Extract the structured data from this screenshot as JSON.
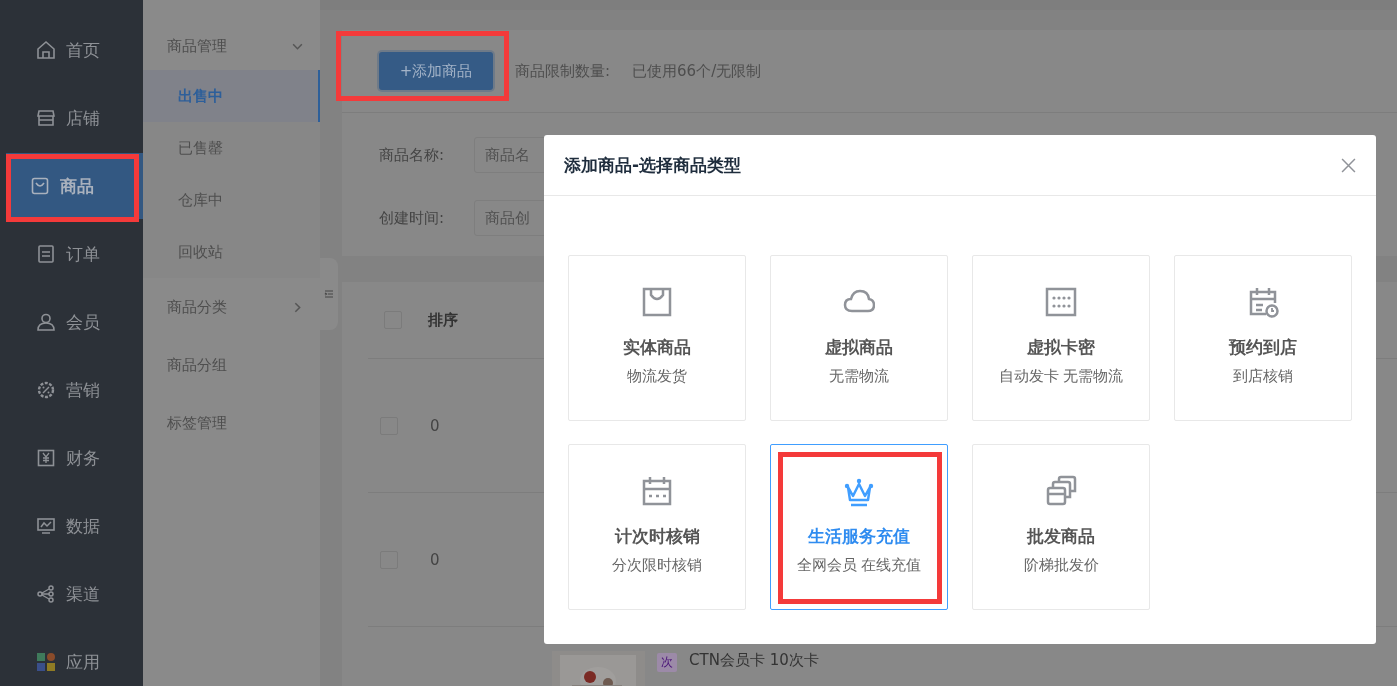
{
  "sidebar": {
    "items": [
      {
        "label": "首页",
        "selected": false,
        "annotated": false
      },
      {
        "label": "店铺",
        "selected": false,
        "annotated": false
      },
      {
        "label": "商品",
        "selected": true,
        "annotated": true
      },
      {
        "label": "订单",
        "selected": false,
        "annotated": false
      },
      {
        "label": "会员",
        "selected": false,
        "annotated": false
      },
      {
        "label": "营销",
        "selected": false,
        "annotated": false
      },
      {
        "label": "财务",
        "selected": false,
        "annotated": false
      },
      {
        "label": "数据",
        "selected": false,
        "annotated": false
      },
      {
        "label": "渠道",
        "selected": false,
        "annotated": false
      },
      {
        "label": "应用",
        "selected": false,
        "annotated": false
      }
    ]
  },
  "submenu": {
    "items": [
      {
        "label": "商品管理",
        "kind": "group",
        "expanded": true,
        "children": [
          {
            "label": "出售中",
            "selected": true
          },
          {
            "label": "已售罄",
            "selected": false
          },
          {
            "label": "仓库中",
            "selected": false
          },
          {
            "label": "回收站",
            "selected": false
          }
        ]
      },
      {
        "label": "商品分类",
        "kind": "group",
        "expanded": false
      },
      {
        "label": "商品分组",
        "kind": "link"
      },
      {
        "label": "标签管理",
        "kind": "link"
      }
    ]
  },
  "toolbar": {
    "add_button": {
      "label": "+添加商品",
      "annotated": true
    },
    "limit_label": "商品限制数量:",
    "limit_value": "已使用66个/无限制"
  },
  "filters": [
    {
      "label": "商品名称:",
      "placeholder": "商品名"
    },
    {
      "label": "创建时间:",
      "placeholder": "商品创"
    }
  ],
  "table": {
    "header_checked": false,
    "columns": [
      "排序"
    ],
    "rows": [
      {
        "checked": false,
        "sort": "0"
      },
      {
        "checked": false,
        "sort": "0"
      }
    ],
    "cut_row": {
      "tag": "次",
      "name": "CTN会员卡 10次卡"
    }
  },
  "dialog": {
    "title": "添加商品-选择商品类型",
    "types": [
      {
        "title": "实体商品",
        "subtitle": "物流发货",
        "selected": false,
        "annotated": false
      },
      {
        "title": "虚拟商品",
        "subtitle": "无需物流",
        "selected": false,
        "annotated": false
      },
      {
        "title": "虚拟卡密",
        "subtitle": "自动发卡 无需物流",
        "selected": false,
        "annotated": false
      },
      {
        "title": "预约到店",
        "subtitle": "到店核销",
        "selected": false,
        "annotated": false
      },
      {
        "title": "计次时核销",
        "subtitle": "分次限时核销",
        "selected": false,
        "annotated": false
      },
      {
        "title": "生活服务充值",
        "subtitle": "全网会员 在线充值",
        "selected": true,
        "annotated": true
      },
      {
        "title": "批发商品",
        "subtitle": "阶梯批发价",
        "selected": false,
        "annotated": false
      }
    ]
  }
}
